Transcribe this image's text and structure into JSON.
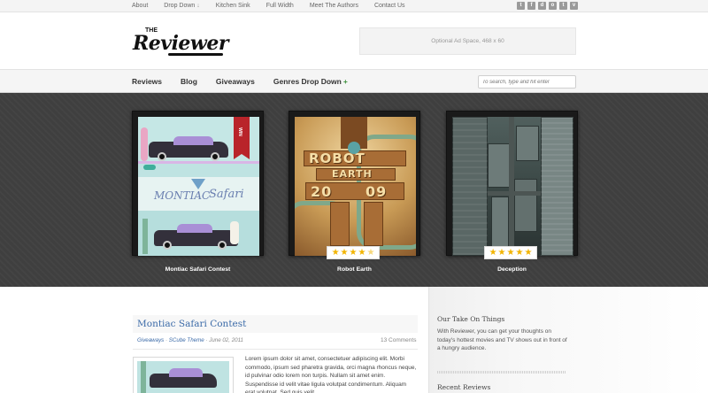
{
  "topnav": {
    "items": [
      "About",
      "Drop Down",
      "Kitchen Sink",
      "Full Width",
      "Meet The Authors",
      "Contact Us"
    ],
    "dropdown_marker": "↓"
  },
  "social": [
    "twitter-icon",
    "facebook-icon",
    "delicious-icon",
    "digg-icon",
    "tumblr-icon",
    "vimeo-icon"
  ],
  "social_glyphs": [
    "t",
    "f",
    "d",
    "o",
    "t",
    "v"
  ],
  "logo": {
    "small": "THE",
    "main": "Reviewer"
  },
  "ad": {
    "text": "Optional Ad Space, 468 x 60"
  },
  "mainnav": {
    "items": [
      "Reviews",
      "Blog",
      "Giveaways",
      "Genres Drop Down"
    ],
    "plus": "+"
  },
  "search": {
    "placeholder": "To search, type and hit enter"
  },
  "showcase": {
    "cards": [
      {
        "title": "Montiac Safari Contest",
        "ribbon": "WIN",
        "rating": null,
        "poster_text": [
          "MONTIAC",
          "Safari"
        ]
      },
      {
        "title": "Robot Earth",
        "rating": 4.5,
        "poster_text": [
          "ROBOT",
          "EARTH",
          "20",
          "09"
        ]
      },
      {
        "title": "Deception",
        "rating": 5
      }
    ]
  },
  "post": {
    "title": "Montiac Safari Contest",
    "categories": [
      "Giveaways",
      "SCube Theme"
    ],
    "date": "June 02, 2011",
    "comments": "13 Comments",
    "excerpt": "Lorem ipsum dolor sit amet, consectetuer adipiscing elit. Morbi commodo, ipsum sed pharetra gravida, orci magna rhoncus neque, id pulvinar odio lorem non turpis. Nullam sit amet enim. Suspendisse id velit vitae ligula volutpat condimentum. Aliquam erat volutpat. Sed quis velit."
  },
  "sidebar": {
    "heading1": "Our Take On Things",
    "text1": "With Reviewer, you can get your thoughts on today's hottest movies and TV shows out in front of a hungry audience.",
    "heading2": "Recent Reviews"
  },
  "colors": {
    "accent_link": "#3c6ba8",
    "star": "#f2b400",
    "ribbon": "#b9242a",
    "plus": "#3b8f3b",
    "showcase_bg": "#3f3f3f"
  }
}
